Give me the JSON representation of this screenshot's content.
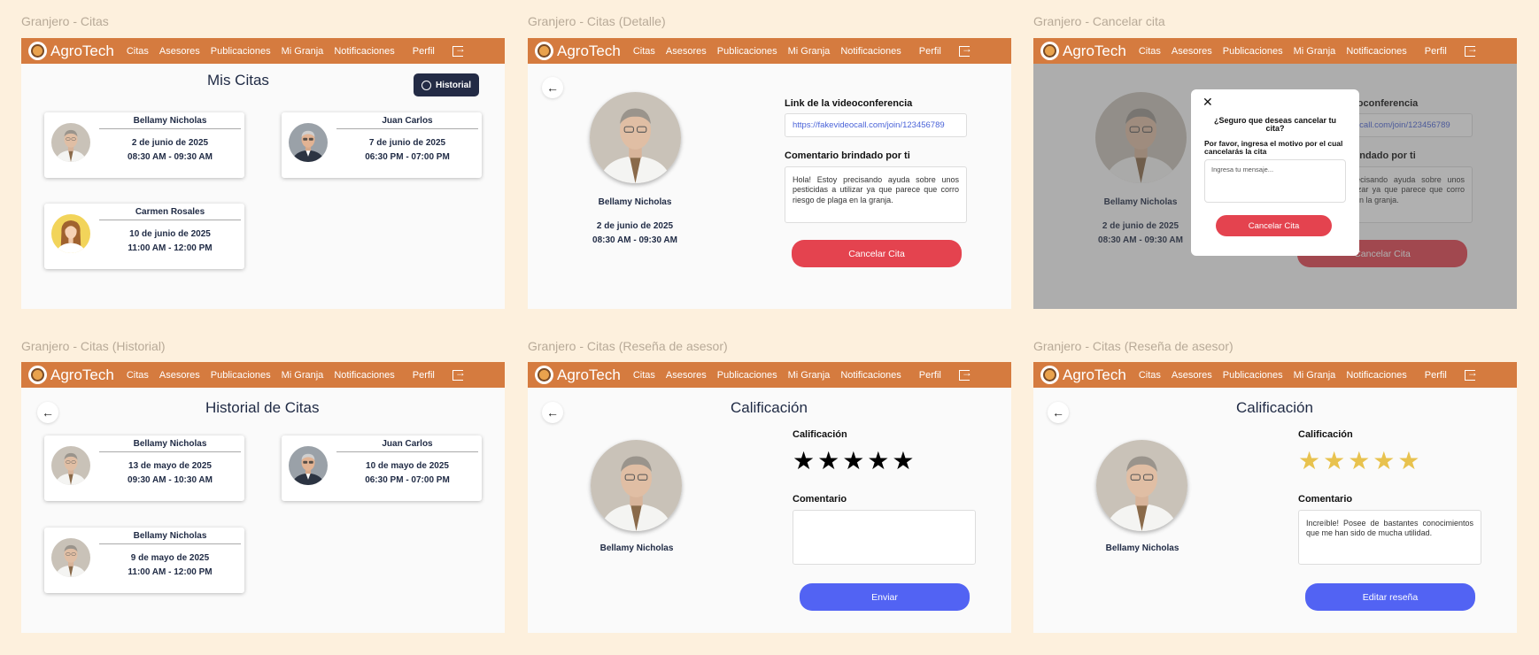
{
  "nav": {
    "brand": "AgroTech",
    "items": [
      "Citas",
      "Asesores",
      "Publicaciones",
      "Mi Granja",
      "Notificaciones",
      "Perfil"
    ]
  },
  "frames": {
    "citas": {
      "label": "Granjero - Citas",
      "title": "Mis Citas",
      "history_button": "Historial",
      "cards": [
        {
          "name": "Bellamy Nicholas",
          "date": "2 de junio de 2025",
          "time": "08:30 AM - 09:30 AM"
        },
        {
          "name": "Juan Carlos",
          "date": "7 de junio de 2025",
          "time": "06:30 PM - 07:00 PM"
        },
        {
          "name": "Carmen Rosales",
          "date": "10 de junio de 2025",
          "time": "11:00 AM - 12:00 PM"
        }
      ]
    },
    "detalle": {
      "label": "Granjero - Citas (Detalle)",
      "name": "Bellamy Nicholas",
      "date": "2 de junio de 2025",
      "time": "08:30 AM - 09:30 AM",
      "link_label": "Link de la videoconferencia",
      "link": "https://fakevideocall.com/join/123456789",
      "comment_label": "Comentario brindado por ti",
      "comment": "Hola! Estoy precisando ayuda sobre unos pesticidas a utilizar ya que parece que corro riesgo de plaga en la granja.",
      "cancel_button": "Cancelar Cita"
    },
    "cancelar": {
      "label": "Granjero - Cancelar cita",
      "question": "¿Seguro que deseas cancelar tu cita?",
      "reason": "Por favor, ingresa el motivo por el cual cancelarás la cita",
      "placeholder": "Ingresa tu mensaje...",
      "button": "Cancelar Cita"
    },
    "historial": {
      "label": "Granjero - Citas (Historial)",
      "title": "Historial de Citas",
      "cards": [
        {
          "name": "Bellamy Nicholas",
          "date": "13 de mayo de 2025",
          "time": "09:30 AM - 10:30 AM"
        },
        {
          "name": "Juan Carlos",
          "date": "10 de mayo de 2025",
          "time": "06:30 PM - 07:00 PM"
        },
        {
          "name": "Bellamy Nicholas",
          "date": "9 de mayo de 2025",
          "time": "11:00 AM - 12:00 PM"
        }
      ]
    },
    "resena": {
      "label": "Granjero - Citas (Reseña de asesor)",
      "title": "Calificación",
      "name": "Bellamy Nicholas",
      "rating_label": "Calificación",
      "rating": 0,
      "comment_label": "Comentario",
      "comment": "",
      "button": "Enviar"
    },
    "resena2": {
      "label": "Granjero - Citas (Reseña de asesor)",
      "title": "Calificación",
      "name": "Bellamy Nicholas",
      "rating_label": "Calificación",
      "rating": 5,
      "comment_label": "Comentario",
      "comment": "Increíble! Posee de bastantes conocimientos que me han sido de mucha utilidad.",
      "button": "Editar reseña"
    }
  },
  "colors": {
    "nav": "#d57b3f",
    "danger": "#e4434f",
    "primary": "#5263f3",
    "star_filled": "#e8c24e",
    "star_empty": "#000000"
  },
  "stars": "★★★★★"
}
